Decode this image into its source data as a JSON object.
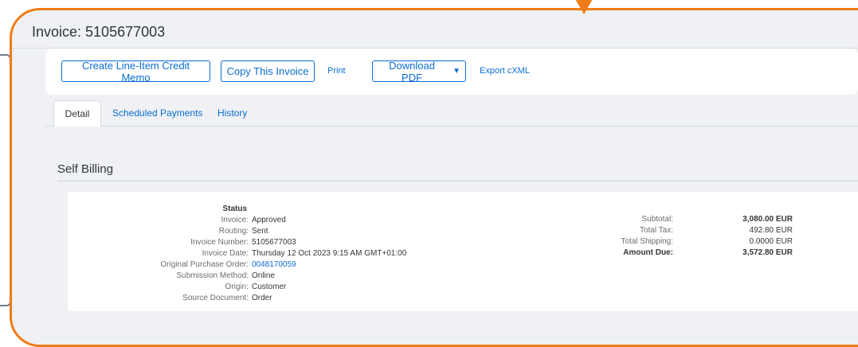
{
  "page": {
    "title": "Invoice: 5105677003"
  },
  "toolbar": {
    "create_credit_memo": "Create Line-Item Credit Memo",
    "copy_invoice": "Copy This Invoice",
    "print": "Print",
    "download_pdf": "Download PDF",
    "download_caret": "▼",
    "export_cxml": "Export cXML"
  },
  "tabs": [
    {
      "label": "Detail"
    },
    {
      "label": "Scheduled Payments"
    },
    {
      "label": "History"
    }
  ],
  "section": {
    "title": "Self Billing"
  },
  "status": {
    "heading": "Status",
    "fields": [
      {
        "label": "Invoice:",
        "value": "Approved"
      },
      {
        "label": "Routing:",
        "value": "Sent"
      },
      {
        "label": "Invoice Number:",
        "value": "5105677003"
      },
      {
        "label": "Invoice Date:",
        "value": "Thursday 12 Oct 2023 9:15 AM GMT+01:00"
      },
      {
        "label": "Original Purchase Order:",
        "value": "0048170059"
      },
      {
        "label": "Submission Method:",
        "value": "Online"
      },
      {
        "label": "Origin:",
        "value": "Customer"
      },
      {
        "label": "Source Document:",
        "value": "Order"
      }
    ]
  },
  "totals": [
    {
      "label": "Subtotal:",
      "value": "3,080.00 EUR"
    },
    {
      "label": "Total Tax:",
      "value": "492.80 EUR"
    },
    {
      "label": "Total Shipping:",
      "value": "0.0000 EUR"
    },
    {
      "label": "Amount Due:",
      "value": "3,572.80 EUR"
    }
  ],
  "colors": {
    "accent": "#0a6ed1",
    "callout_border": "#f07c18",
    "page_bg": "#eff1f4"
  }
}
